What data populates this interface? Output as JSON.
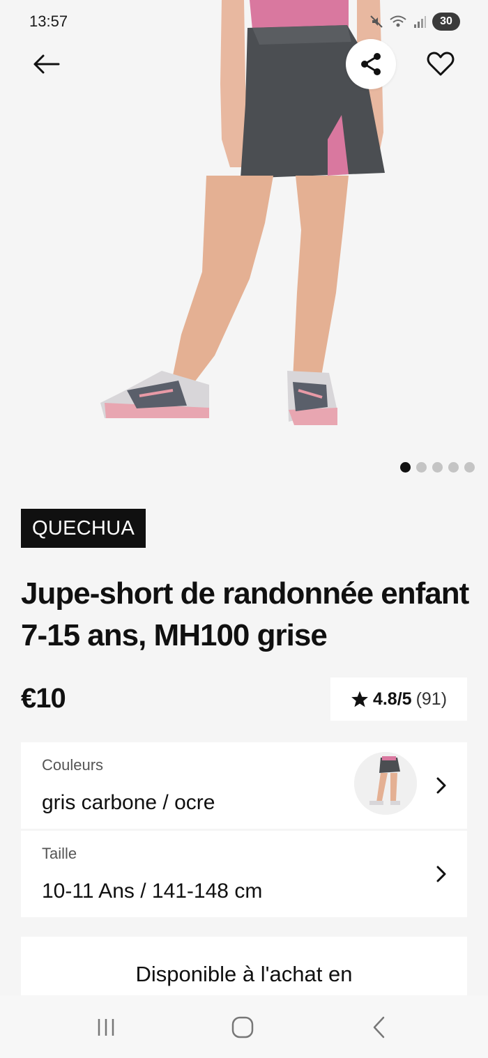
{
  "status_bar": {
    "time": "13:57",
    "battery": "30"
  },
  "hero": {
    "image_icon": "product-photo-skirt-short",
    "carousel_total": 5,
    "carousel_active": 0
  },
  "actions": {
    "back_icon": "arrow-left-icon",
    "share_icon": "share-icon",
    "favorite_icon": "heart-outline-icon"
  },
  "product": {
    "brand": "QUECHUA",
    "title": "Jupe-short de randonnée enfant 7-15 ans, MH100 grise",
    "price": "€10",
    "rating_score": "4.8/5",
    "rating_count": "(91)"
  },
  "options": {
    "colors_label": "Couleurs",
    "colors_value": "gris carbone / ocre",
    "size_label": "Taille",
    "size_value": "10-11 Ans / 141-148 cm"
  },
  "availability": {
    "text": "Disponible à l'achat en"
  },
  "colors": {
    "background": "#f5f5f5",
    "brand_tag": "#101010",
    "card": "#ffffff",
    "skirt_grey": "#4b4e52",
    "pink_accent": "#d9789f"
  }
}
